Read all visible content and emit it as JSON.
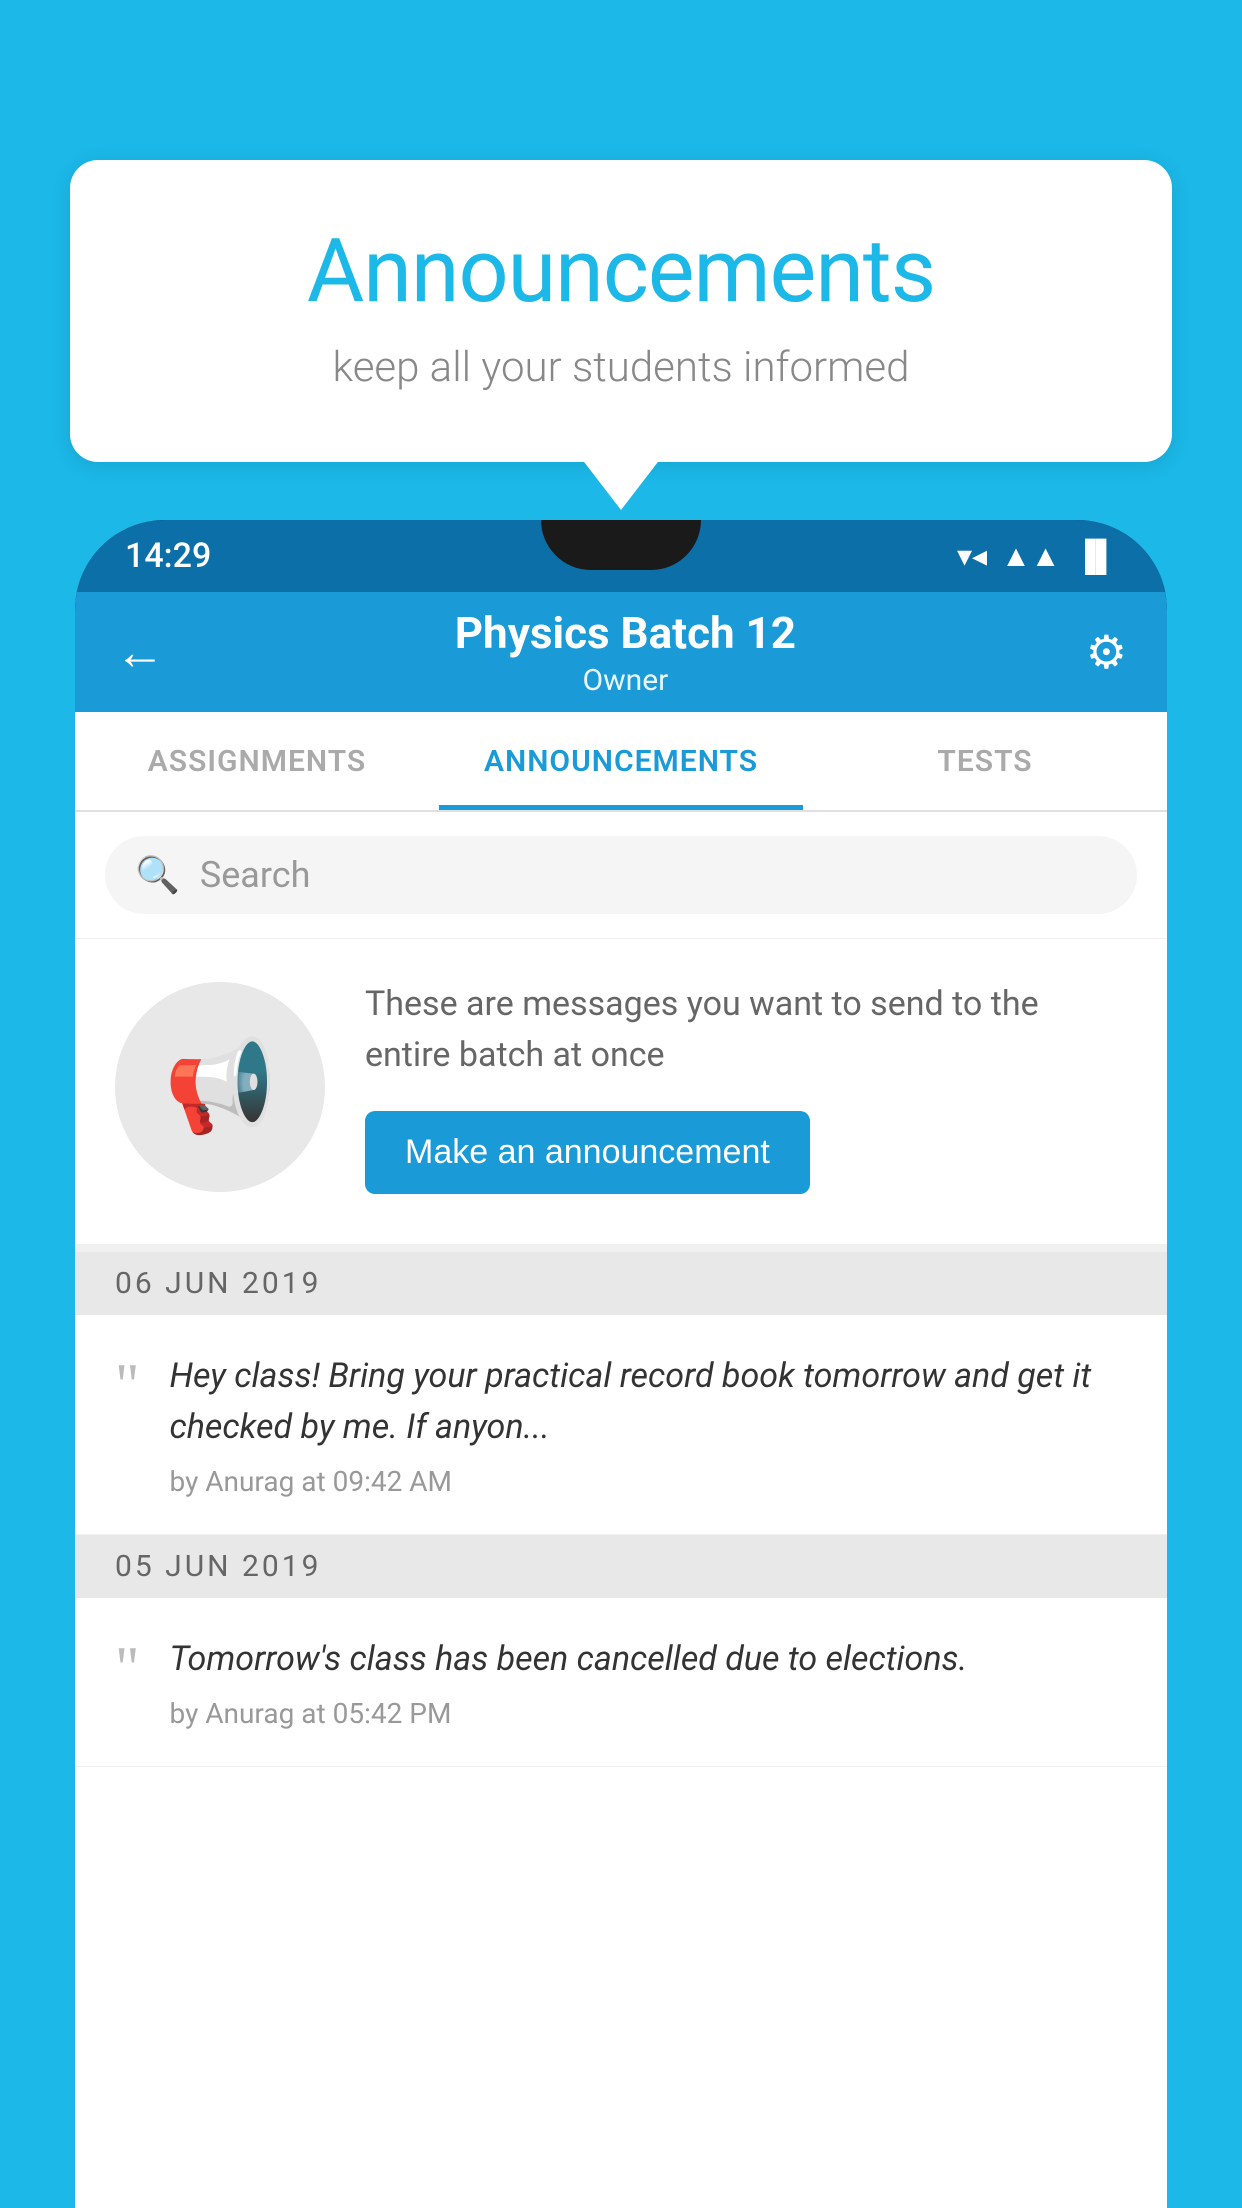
{
  "background_color": "#1bb8e8",
  "bubble": {
    "title": "Announcements",
    "subtitle": "keep all your students informed"
  },
  "status_bar": {
    "time": "14:29",
    "wifi": "▼",
    "signal": "▲",
    "battery": "▐"
  },
  "header": {
    "title": "Physics Batch 12",
    "subtitle": "Owner",
    "back_label": "←",
    "settings_label": "⚙"
  },
  "tabs": [
    {
      "label": "ASSIGNMENTS",
      "active": false
    },
    {
      "label": "ANNOUNCEMENTS",
      "active": true
    },
    {
      "label": "TESTS",
      "active": false
    }
  ],
  "search": {
    "placeholder": "Search"
  },
  "promo": {
    "description": "These are messages you want to send to the entire batch at once",
    "button_label": "Make an announcement"
  },
  "date_groups": [
    {
      "date": "06  JUN  2019",
      "items": [
        {
          "text": "Hey class! Bring your practical record book tomorrow and get it checked by me. If anyon...",
          "meta": "by Anurag at 09:42 AM"
        }
      ]
    },
    {
      "date": "05  JUN  2019",
      "items": [
        {
          "text": "Tomorrow's class has been cancelled due to elections.",
          "meta": "by Anurag at 05:42 PM"
        }
      ]
    }
  ]
}
